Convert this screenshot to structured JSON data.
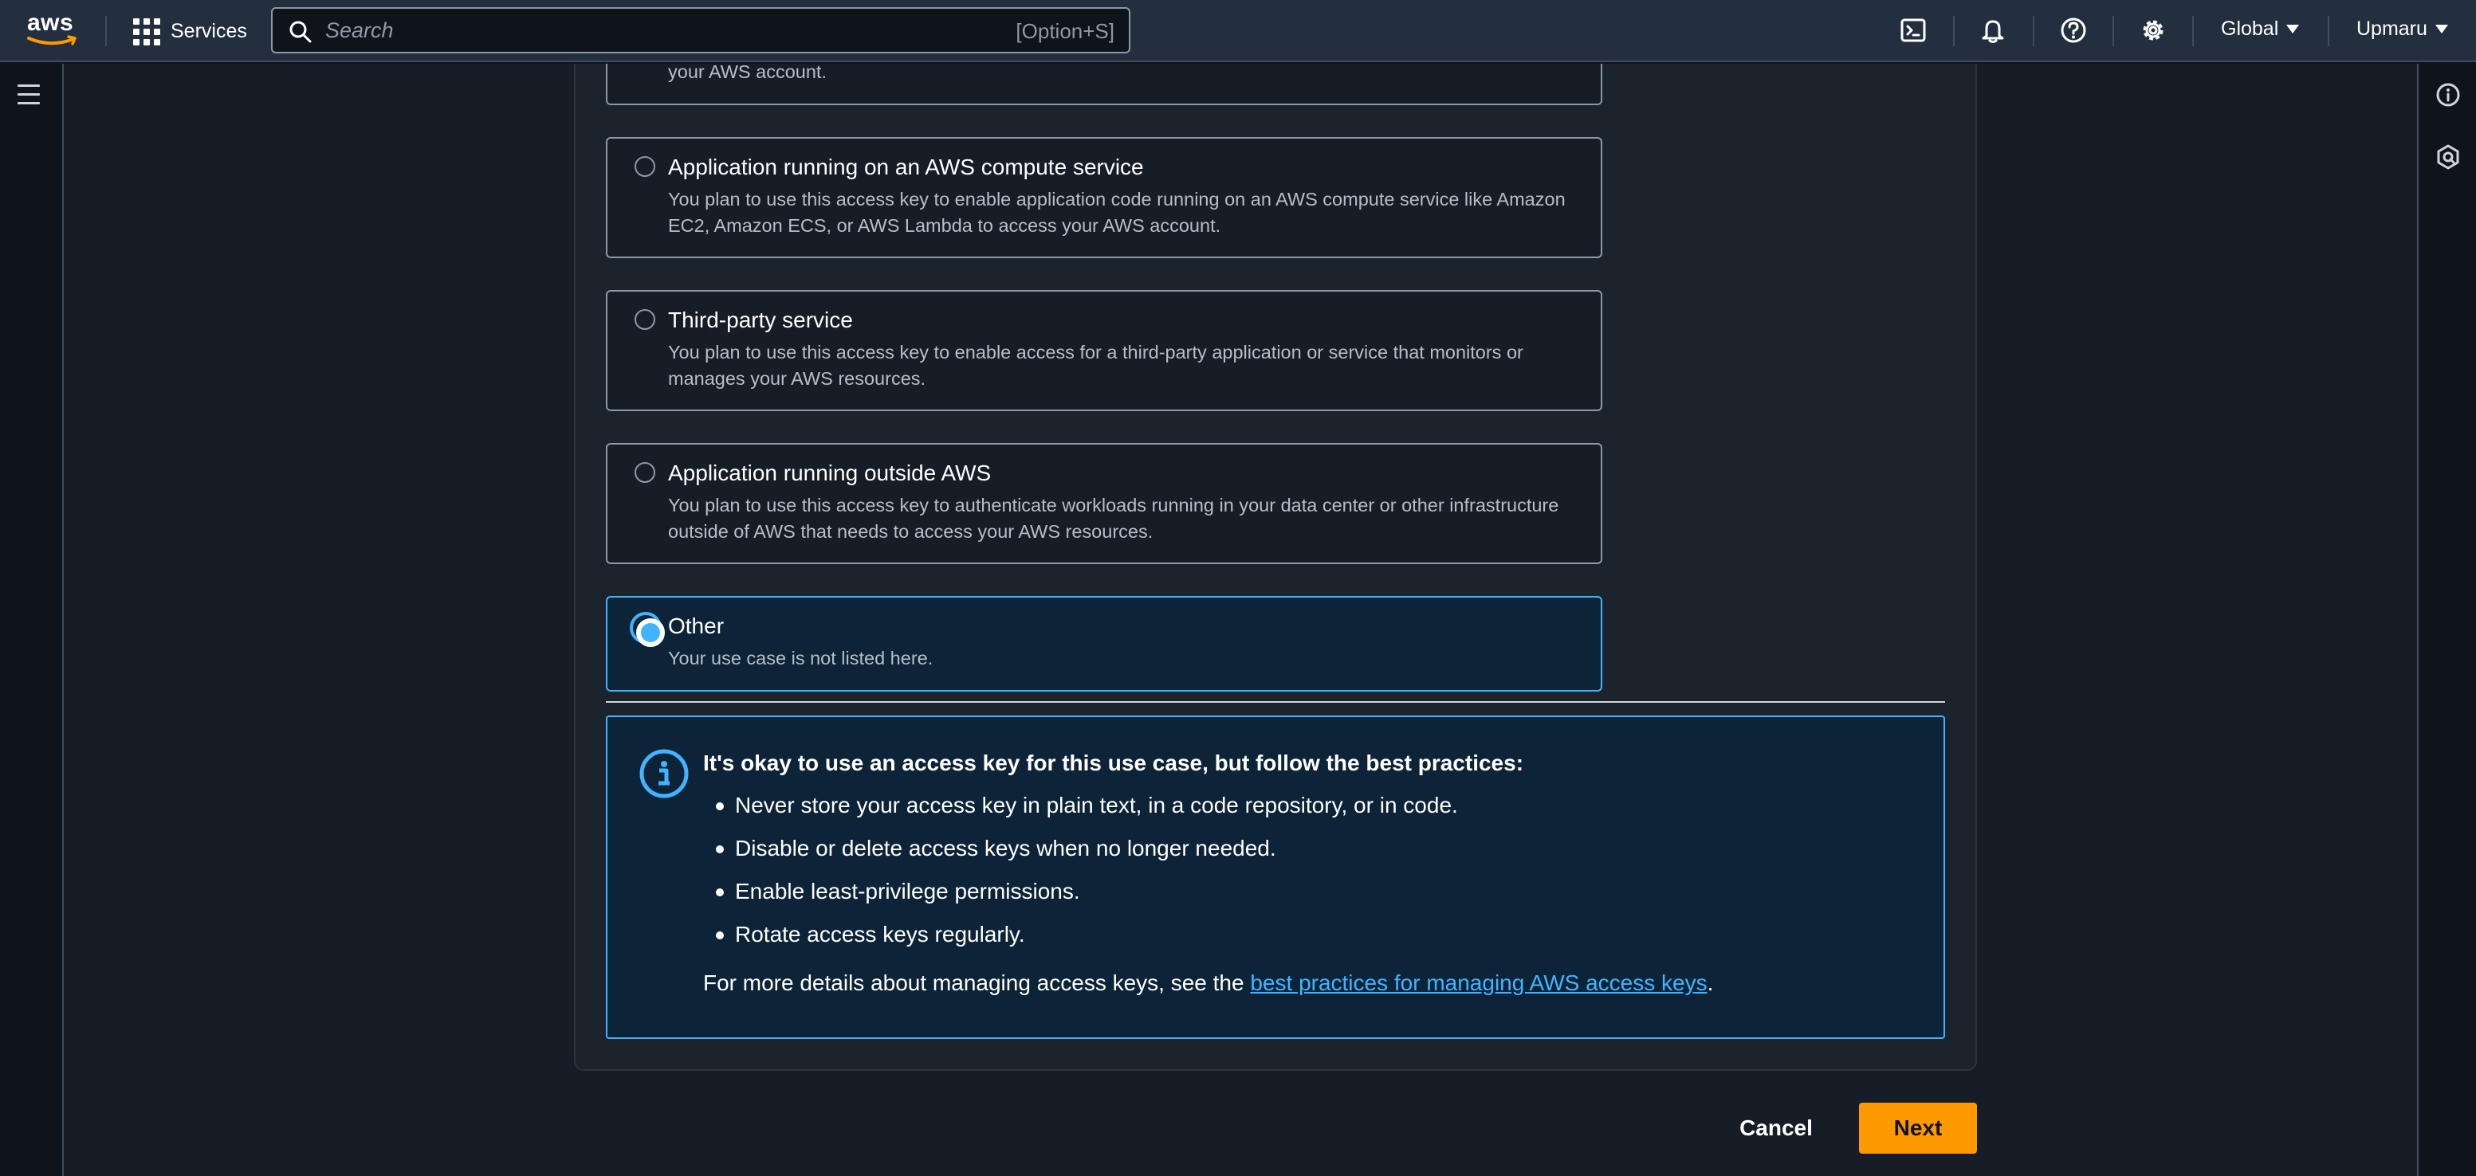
{
  "nav": {
    "logo_text": "aws",
    "services_label": "Services",
    "search_placeholder": "Search",
    "search_shortcut": "[Option+S]",
    "region": "Global",
    "account": "Upmaru",
    "icons": [
      "cloudshell-icon",
      "notifications-icon",
      "help-icon",
      "settings-icon"
    ]
  },
  "use_case_options": [
    {
      "title": "",
      "description": "your AWS account.",
      "selected": false
    },
    {
      "title": "Application running on an AWS compute service",
      "description": "You plan to use this access key to enable application code running on an AWS compute service like Amazon EC2, Amazon ECS, or AWS Lambda to access your AWS account.",
      "selected": false
    },
    {
      "title": "Third-party service",
      "description": "You plan to use this access key to enable access for a third-party application or service that monitors or manages your AWS resources.",
      "selected": false
    },
    {
      "title": "Application running outside AWS",
      "description": "You plan to use this access key to authenticate workloads running in your data center or other infrastructure outside of AWS that needs to access your AWS resources.",
      "selected": false
    },
    {
      "title": "Other",
      "description": "Your use case is not listed here.",
      "selected": true
    }
  ],
  "alert": {
    "title": "It's okay to use an access key for this use case, but follow the best practices:",
    "items": [
      "Never store your access key in plain text, in a code repository, or in code.",
      "Disable or delete access keys when no longer needed.",
      "Enable least-privilege permissions.",
      "Rotate access keys regularly."
    ],
    "footer_prefix": "For more details about managing access keys, see the ",
    "footer_link": "best practices for managing AWS access keys",
    "footer_suffix": "."
  },
  "actions": {
    "cancel_label": "Cancel",
    "next_label": "Next"
  },
  "colors": {
    "accent": "#42b4ff",
    "primary_button": "#ff9900",
    "nav_bg": "#232f3e"
  }
}
